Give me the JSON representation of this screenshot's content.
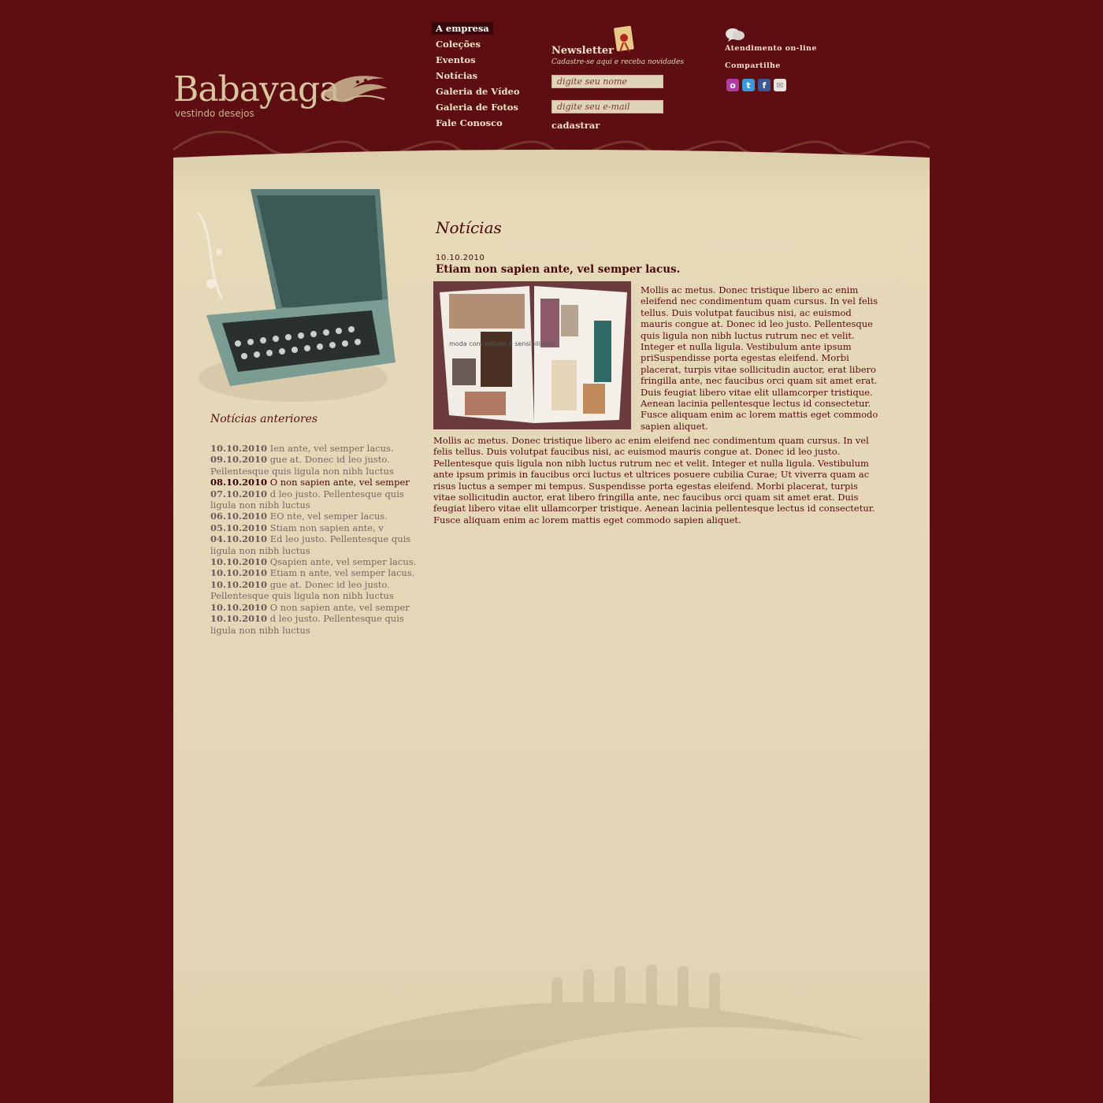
{
  "brand": {
    "name": "Babayaga",
    "tagline": "vestindo desejos"
  },
  "nav": {
    "items": [
      {
        "label": "A empresa",
        "active": true
      },
      {
        "label": "Coleções"
      },
      {
        "label": "Eventos"
      },
      {
        "label": "Notícias"
      },
      {
        "label": "Galeria de Vídeo"
      },
      {
        "label": "Galeria de Fotos"
      },
      {
        "label": "Fale Conosco"
      }
    ]
  },
  "newsletter": {
    "title": "Newsletter",
    "subtitle": "Cadastre-se aqui e receba novidades",
    "name_placeholder": "digite seu nome",
    "email_placeholder": "digite seu e-mail",
    "submit_label": "cadastrar"
  },
  "side": {
    "support_label": "Atendimento on-line",
    "share_label": "Compartilhe",
    "share_icons": [
      "orkut-icon",
      "twitter-icon",
      "facebook-icon",
      "email-icon"
    ]
  },
  "previous_news": {
    "title": "Notícias anteriores",
    "items": [
      {
        "date": "10.10.2010",
        "text": "Ien ante, vel semper lacus."
      },
      {
        "date": "09.10.2010",
        "text": "gue at. Donec id leo justo. Pellentesque quis ligula non nibh luctus"
      },
      {
        "date": "08.10.2010",
        "text": "O non sapien ante, vel semper",
        "active": true
      },
      {
        "date": "07.10.2010",
        "text": "d leo justo. Pellentesque quis ligula non nibh luctus"
      },
      {
        "date": "06.10.2010",
        "text": "EO nte, vel semper lacus."
      },
      {
        "date": "05.10.2010",
        "text": "Stiam non sapien ante, v"
      },
      {
        "date": "04.10.2010",
        "text": "Ed leo justo. Pellentesque quis ligula non nibh luctus"
      },
      {
        "date": "10.10.2010",
        "text": "Qsapien ante, vel semper lacus."
      },
      {
        "date": "10.10.2010",
        "text": "Etiam n ante, vel semper lacus."
      },
      {
        "date": "10.10.2010",
        "text": "gue at. Donec id leo justo. Pellentesque quis ligula non nibh luctus"
      },
      {
        "date": "10.10.2010",
        "text": "O non sapien ante, vel semper"
      },
      {
        "date": "10.10.2010",
        "text": "d leo justo. Pellentesque quis ligula non nibh luctus"
      }
    ]
  },
  "main": {
    "section_title": "Notícias",
    "article": {
      "date": "10.10.2010",
      "headline": "Etiam non sapien ante, vel semper lacus.",
      "image_caption": "moda com atitude e sensibilidade",
      "p1": "Mollis ac metus. Donec tristique libero ac enim eleifend nec condimentum quam cursus. In vel felis tellus. Duis volutpat faucibus nisi, ac euismod mauris congue at. Donec id leo justo. Pellentesque quis ligula non nibh luctus rutrum nec et velit. Integer et nulla ligula. Vestibulum ante ipsum priSuspendisse porta egestas eleifend. Morbi placerat, turpis vitae sollicitudin auctor, erat libero fringilla ante, nec faucibus orci quam sit amet erat. Duis feugiat libero vitae elit ullamcorper tristique. Aenean lacinia pellentesque lectus id consectetur. Fusce aliquam enim ac lorem mattis eget commodo sapien aliquet.",
      "p2": "Mollis ac metus. Donec tristique libero ac enim eleifend nec condimentum quam cursus. In vel felis tellus. Duis volutpat faucibus nisi, ac euismod mauris congue at. Donec id leo justo. Pellentesque quis ligula non nibh luctus rutrum nec et velit. Integer et nulla ligula. Vestibulum ante ipsum primis in faucibus orci luctus et ultrices posuere cubilia Curae; Ut viverra quam ac risus luctus a semper mi tempus. Suspendisse porta egestas eleifend. Morbi placerat, turpis vitae sollicitudin auctor, erat libero fringilla ante, nec faucibus orci quam sit amet erat. Duis feugiat libero vitae elit ullamcorper tristique. Aenean lacinia pellentesque lectus id consectetur. Fusce aliquam enim ac lorem mattis eget commodo sapien aliquet."
    }
  },
  "colors": {
    "background": "#5f0e12",
    "panel": "#e4d8b8",
    "text_dark": "#5a0a0e",
    "nav_text": "#f1e2c8"
  }
}
